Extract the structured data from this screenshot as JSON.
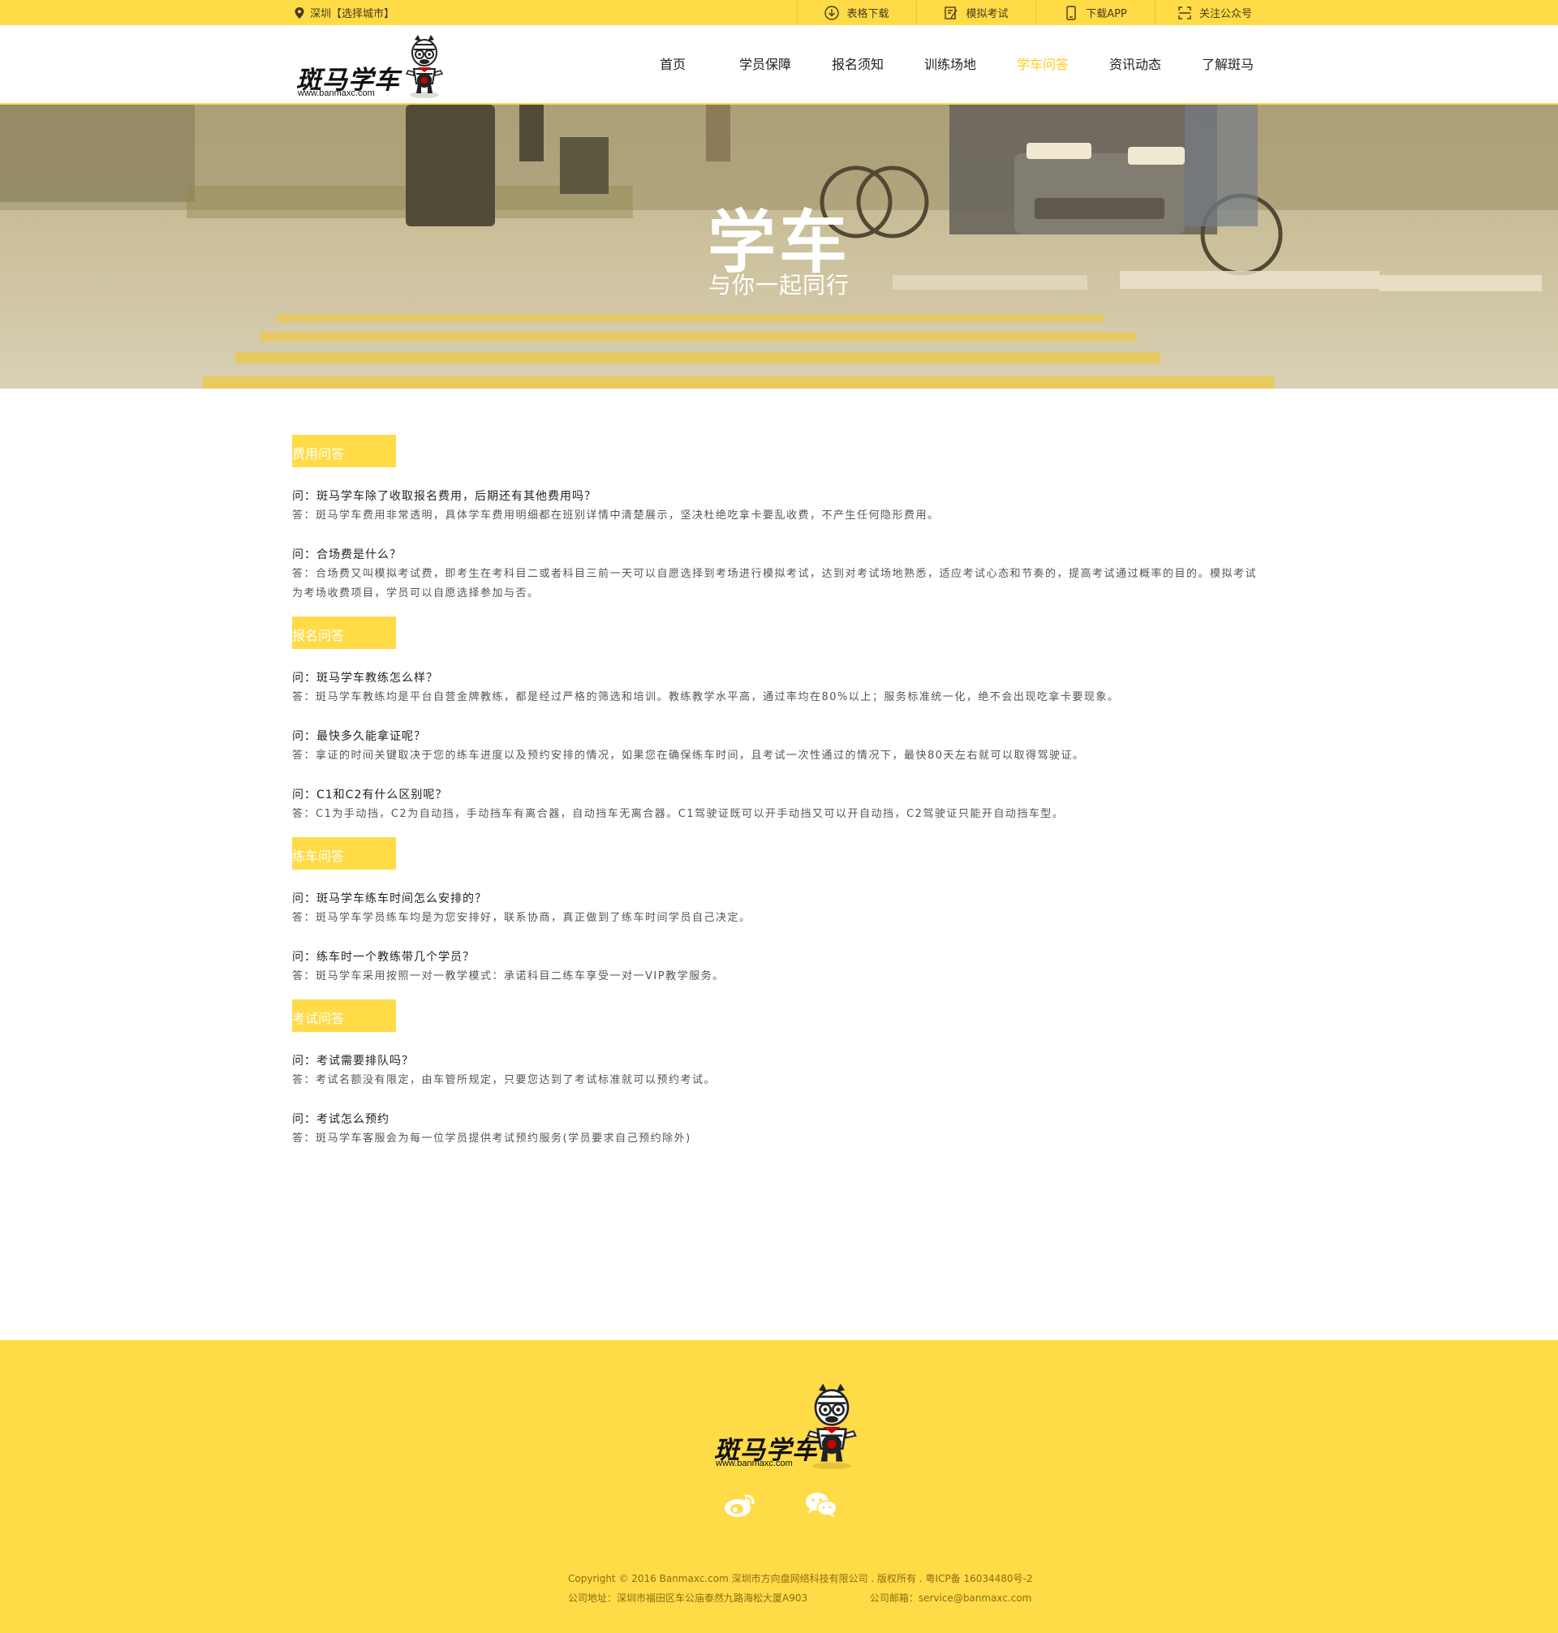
{
  "topbar": {
    "city": "深圳【选择城市】",
    "links": [
      {
        "label": "表格下载",
        "icon": "download-icon"
      },
      {
        "label": "模拟考试",
        "icon": "edit-icon"
      },
      {
        "label": "下载APP",
        "icon": "mobile-icon"
      },
      {
        "label": "关注公众号",
        "icon": "qrcode-icon"
      }
    ]
  },
  "header": {
    "logo_text": "斑马学车",
    "logo_url": "www.banmaxc.com",
    "nav": [
      {
        "label": "首页",
        "active": false
      },
      {
        "label": "学员保障",
        "active": false
      },
      {
        "label": "报名须知",
        "active": false
      },
      {
        "label": "训练场地",
        "active": false
      },
      {
        "label": "学车问答",
        "active": true
      },
      {
        "label": "资讯动态",
        "active": false
      },
      {
        "label": "了解斑马",
        "active": false
      }
    ]
  },
  "banner": {
    "title": "学车",
    "subtitle": "与你一起同行"
  },
  "sections": [
    {
      "title": "费用问答",
      "items": [
        {
          "q": "问：斑马学车除了收取报名费用，后期还有其他费用吗？",
          "a": "答：斑马学车费用非常透明，具体学车费用明细都在班别详情中清楚展示，坚决杜绝吃拿卡要乱收费，不产生任何隐形费用。"
        },
        {
          "q": "问：合场费是什么？",
          "a": "答：合场费又叫模拟考试费，即考生在考科目二或者科目三前一天可以自愿选择到考场进行模拟考试，达到对考试场地熟悉，适应考试心态和节奏的，提高考试通过概率的目的。模拟考试为考场收费项目，学员可以自愿选择参加与否。"
        }
      ]
    },
    {
      "title": "报名问答",
      "items": [
        {
          "q": "问：斑马学车教练怎么样？",
          "a": "答：斑马学车教练均是平台自营金牌教练，都是经过严格的筛选和培训。教练教学水平高，通过率均在80%以上；服务标准统一化，绝不会出现吃拿卡要现象。"
        },
        {
          "q": "问：最快多久能拿证呢？",
          "a": "答：拿证的时间关键取决于您的练车进度以及预约安排的情况，如果您在确保练车时间，且考试一次性通过的情况下，最快80天左右就可以取得驾驶证。"
        },
        {
          "q": "问：C1和C2有什么区别呢？",
          "a": "答：C1为手动挡，C2为自动挡，手动挡车有离合器，自动挡车无离合器。C1驾驶证既可以开手动挡又可以开自动挡，C2驾驶证只能开自动挡车型。"
        }
      ]
    },
    {
      "title": "练车问答",
      "items": [
        {
          "q": "问：斑马学车练车时间怎么安排的？",
          "a": "答：斑马学车学员练车均是为您安排好，联系协商，真正做到了练车时间学员自己决定。"
        },
        {
          "q": "问：练车时一个教练带几个学员？",
          "a": "答：斑马学车采用按照一对一教学模式：承诺科目二练车享受一对一VIP教学服务。"
        }
      ]
    },
    {
      "title": "考试问答",
      "items": [
        {
          "q": "问：考试需要排队吗？",
          "a": "答：考试名额没有限定，由车管所规定，只要您达到了考试标准就可以预约考试。"
        },
        {
          "q": "问：考试怎么预约",
          "a": "答：斑马学车客服会为每一位学员提供考试预约服务(学员要求自己预约除外)"
        }
      ]
    }
  ],
  "footer": {
    "logo_text": "斑马学车",
    "logo_url": "www.banmaxc.com",
    "social": [
      {
        "icon": "weibo-icon"
      },
      {
        "icon": "wechat-icon"
      }
    ],
    "copyright": "Copyright © 2016 Banmaxc.com    深圳市方向盘网络科技有限公司 . 版权所有 . 粤ICP备 16034480号-2",
    "address": "公司地址：深圳市福田区车公庙泰然九路海松大厦A903",
    "email": "公司邮箱：service@banmaxc.com"
  },
  "colors": {
    "brand_yellow": "#ffdb47",
    "nav_active": "#ffcc1f"
  }
}
